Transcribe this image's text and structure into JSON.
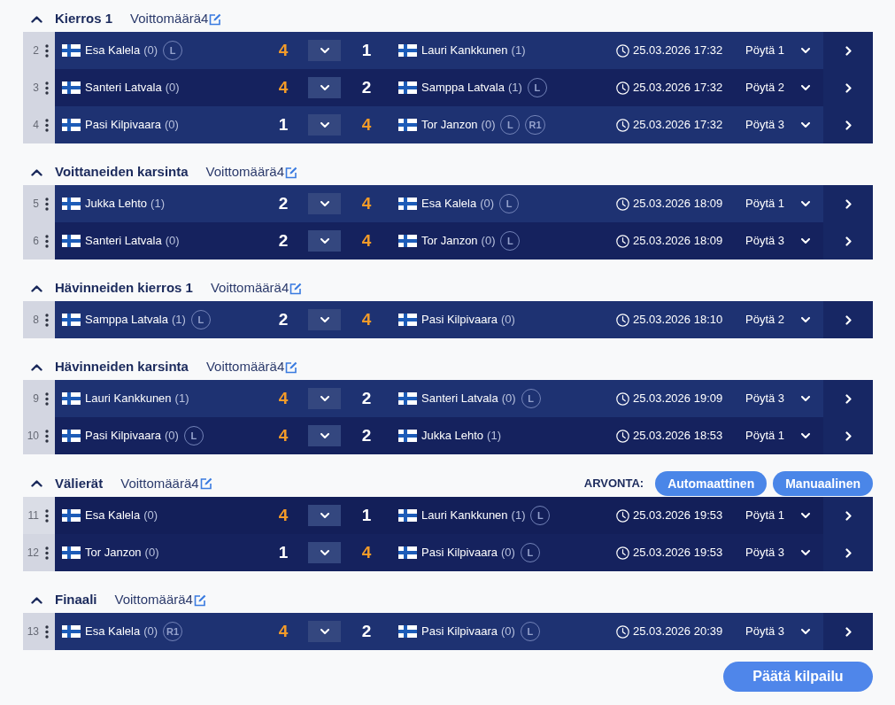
{
  "sections": [
    {
      "title": "Kierros 1",
      "win_target": "Voittomäärä4",
      "expanded": true,
      "matches": [
        {
          "number": "2",
          "hovered": false,
          "player1": {
            "name": "Esa Kalela",
            "record": "(0)",
            "badges": [
              "L"
            ],
            "score": "4",
            "winner": true
          },
          "player2": {
            "name": "Lauri Kankkunen",
            "record": "(1)",
            "score": "1",
            "winner": false
          },
          "datetime": "25.03.2026 17:32",
          "table": "Pöytä 1"
        },
        {
          "number": "3",
          "hovered": false,
          "player1": {
            "name": "Santeri Latvala",
            "record": "(0)",
            "score": "4",
            "winner": true
          },
          "player2": {
            "name": "Samppa Latvala",
            "record": "(1)",
            "badges": [
              "L"
            ],
            "score": "2",
            "winner": false
          },
          "datetime": "25.03.2026 17:32",
          "table": "Pöytä 2"
        },
        {
          "number": "4",
          "hovered": false,
          "player1": {
            "name": "Pasi Kilpivaara",
            "record": "(0)",
            "score": "1",
            "winner": false
          },
          "player2": {
            "name": "Tor Janzon",
            "record": "(0)",
            "badges": [
              "L",
              "R1"
            ],
            "score": "4",
            "winner": true
          },
          "datetime": "25.03.2026 17:32",
          "table": "Pöytä 3"
        }
      ]
    },
    {
      "title": "Voittaneiden karsinta",
      "win_target": "Voittomäärä4",
      "expanded": true,
      "matches": [
        {
          "number": "5",
          "hovered": false,
          "player1": {
            "name": "Jukka Lehto",
            "record": "(1)",
            "score": "2",
            "winner": false
          },
          "player2": {
            "name": "Esa Kalela",
            "record": "(0)",
            "badges": [
              "L"
            ],
            "score": "4",
            "winner": true
          },
          "datetime": "25.03.2026 18:09",
          "table": "Pöytä 1"
        },
        {
          "number": "6",
          "hovered": false,
          "player1": {
            "name": "Santeri Latvala",
            "record": "(0)",
            "score": "2",
            "winner": false
          },
          "player2": {
            "name": "Tor Janzon",
            "record": "(0)",
            "badges": [
              "L"
            ],
            "score": "4",
            "winner": true
          },
          "datetime": "25.03.2026 18:09",
          "table": "Pöytä 3"
        }
      ]
    },
    {
      "title": "Hävinneiden kierros 1",
      "win_target": "Voittomäärä4",
      "expanded": true,
      "matches": [
        {
          "number": "8",
          "hovered": false,
          "player1": {
            "name": "Samppa Latvala",
            "record": "(1)",
            "badges": [
              "L"
            ],
            "score": "2",
            "winner": false
          },
          "player2": {
            "name": "Pasi Kilpivaara",
            "record": "(0)",
            "score": "4",
            "winner": true
          },
          "datetime": "25.03.2026 18:10",
          "table": "Pöytä 2"
        }
      ]
    },
    {
      "title": "Hävinneiden karsinta",
      "win_target": "Voittomäärä4",
      "expanded": true,
      "matches": [
        {
          "number": "9",
          "hovered": false,
          "player1": {
            "name": "Lauri Kankkunen",
            "record": "(1)",
            "score": "4",
            "winner": true
          },
          "player2": {
            "name": "Santeri Latvala",
            "record": "(0)",
            "badges": [
              "L"
            ],
            "score": "2",
            "winner": false
          },
          "datetime": "25.03.2026 19:09",
          "table": "Pöytä 3"
        },
        {
          "number": "10",
          "hovered": false,
          "player1": {
            "name": "Pasi Kilpivaara",
            "record": "(0)",
            "badges": [
              "L"
            ],
            "score": "4",
            "winner": true
          },
          "player2": {
            "name": "Jukka Lehto",
            "record": "(1)",
            "score": "2",
            "winner": false
          },
          "datetime": "25.03.2026 18:53",
          "table": "Pöytä 1"
        }
      ]
    },
    {
      "title": "Välierät",
      "win_target": "Voittomäärä4",
      "expanded": true,
      "draw": {
        "label": "ARVONTA:",
        "buttons": [
          "Automaattinen",
          "Manuaalinen"
        ]
      },
      "matches": [
        {
          "number": "11",
          "hovered": true,
          "player1": {
            "name": "Esa Kalela",
            "record": "(0)",
            "score": "4",
            "winner": true
          },
          "player2": {
            "name": "Lauri Kankkunen",
            "record": "(1)",
            "badges": [
              "L"
            ],
            "score": "1",
            "winner": false
          },
          "datetime": "25.03.2026 19:53",
          "table": "Pöytä 1"
        },
        {
          "number": "12",
          "hovered": false,
          "player1": {
            "name": "Tor Janzon",
            "record": "(0)",
            "score": "1",
            "winner": false
          },
          "player2": {
            "name": "Pasi Kilpivaara",
            "record": "(0)",
            "badges": [
              "L"
            ],
            "score": "4",
            "winner": true
          },
          "datetime": "25.03.2026 19:53",
          "table": "Pöytä 3"
        }
      ]
    },
    {
      "title": "Finaali",
      "win_target": "Voittomäärä4",
      "expanded": true,
      "matches": [
        {
          "number": "13",
          "hovered": false,
          "player1": {
            "name": "Esa Kalela",
            "record": "(0)",
            "badges": [
              "R1"
            ],
            "score": "4",
            "winner": true
          },
          "player2": {
            "name": "Pasi Kilpivaara",
            "record": "(0)",
            "badges": [
              "L"
            ],
            "score": "2",
            "winner": false
          },
          "datetime": "25.03.2026 20:39",
          "table": "Pöytä 3"
        }
      ]
    }
  ],
  "finish_button": "Päätä kilpailu"
}
